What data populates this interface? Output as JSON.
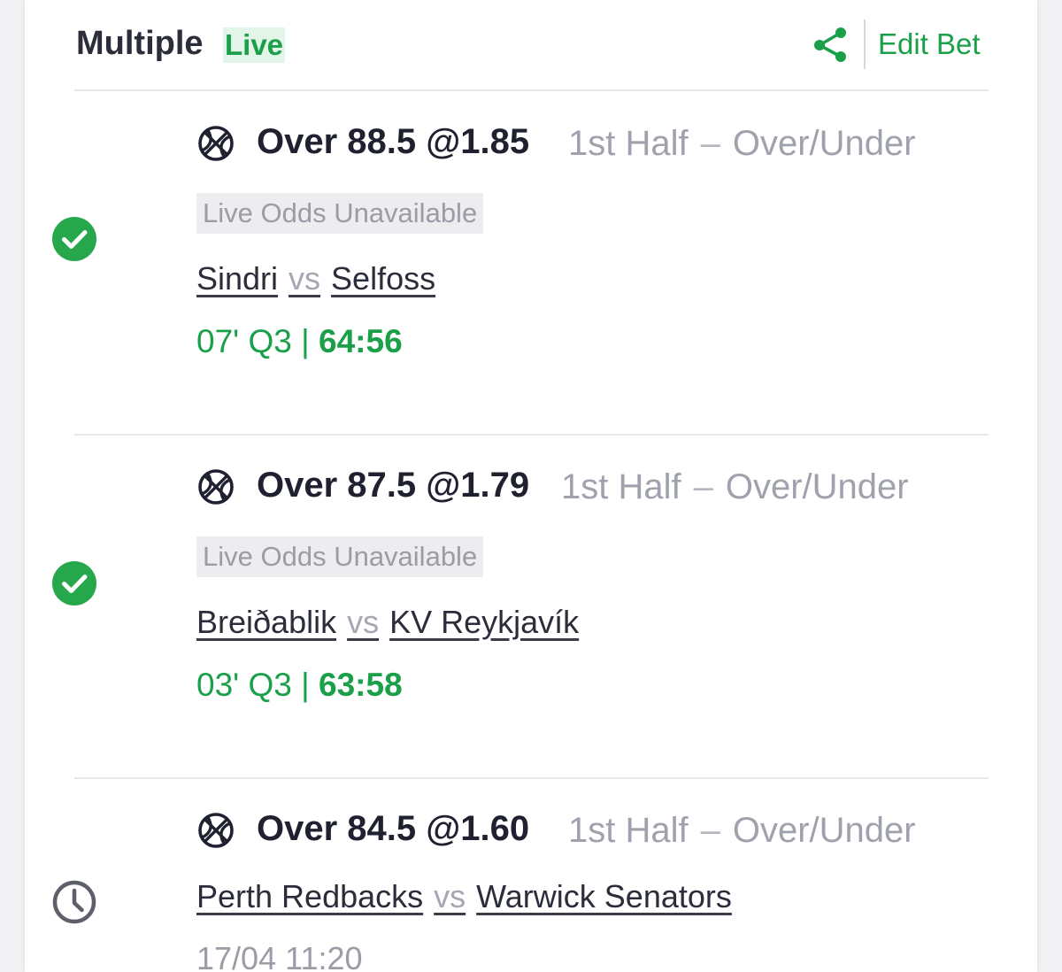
{
  "header": {
    "title": "Multiple",
    "live_badge": "Live",
    "edit_bet_label": "Edit Bet",
    "share_icon": "share-icon"
  },
  "colors": {
    "accent_green": "#1ba04a",
    "text_dark": "#1f2130",
    "text_muted": "#9fa2ad",
    "status_settled_green": "#27a74b",
    "status_pending_grey": "#5d5f69"
  },
  "selections": [
    {
      "status": "won",
      "status_icon": "check-circle-icon",
      "sport_icon": "basketball-icon",
      "pick": "Over 88.5 @1.85",
      "market_period": "1st Half",
      "market_dash": "–",
      "market_type": "Over/Under",
      "odds_note": "Live Odds Unavailable",
      "home": "Sindri",
      "vs": "vs",
      "away": "Selfoss",
      "clock": "07' Q3 |",
      "score": "64:56"
    },
    {
      "status": "won",
      "status_icon": "check-circle-icon",
      "sport_icon": "basketball-icon",
      "pick": "Over 87.5 @1.79",
      "market_period": "1st Half",
      "market_dash": "–",
      "market_type": "Over/Under",
      "odds_note": "Live Odds Unavailable",
      "home": "Breiðablik",
      "vs": "vs",
      "away": "KV Reykjavík",
      "clock": "03' Q3 |",
      "score": "63:58"
    },
    {
      "status": "pending",
      "status_icon": "clock-icon",
      "sport_icon": "basketball-icon",
      "pick": "Over 84.5 @1.60",
      "market_period": "1st Half",
      "market_dash": "–",
      "market_type": "Over/Under",
      "home": "Perth Redbacks",
      "vs": "vs",
      "away": "Warwick Senators",
      "kickoff": "17/04 11:20"
    }
  ]
}
